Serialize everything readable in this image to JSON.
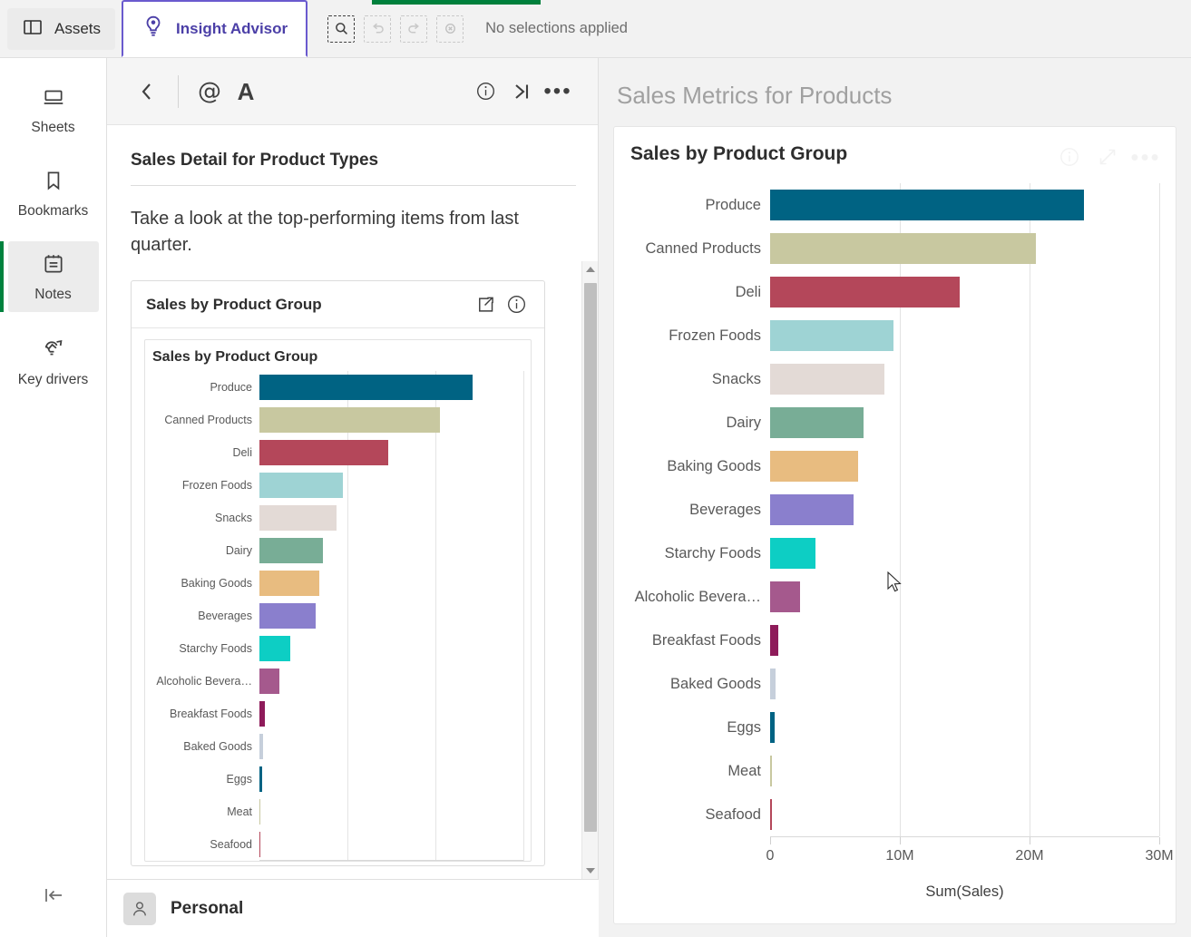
{
  "topbar": {
    "assets_label": "Assets",
    "insight_advisor_label": "Insight Advisor",
    "selection_status": "No selections applied",
    "tools": [
      {
        "name": "selection-search",
        "title": "Selection search",
        "disabled": false
      },
      {
        "name": "step-back",
        "title": "Step back",
        "disabled": true
      },
      {
        "name": "step-forward",
        "title": "Step forward",
        "disabled": true
      },
      {
        "name": "clear-selections",
        "title": "Clear all selections",
        "disabled": true
      }
    ]
  },
  "rail": {
    "items": [
      {
        "label": "Sheets",
        "icon": "sheets-icon",
        "active": false
      },
      {
        "label": "Bookmarks",
        "icon": "bookmark-icon",
        "active": false
      },
      {
        "label": "Notes",
        "icon": "notes-icon",
        "active": true
      },
      {
        "label": "Key drivers",
        "icon": "key-drivers-icon",
        "active": false
      }
    ],
    "collapse_label": "Collapse"
  },
  "note": {
    "toolbar": {
      "back_label": "‹",
      "mention_label": "@",
      "font_label": "A",
      "info_label": "i",
      "collapse_label": "›|",
      "more_label": "•••"
    },
    "title": "Sales Detail for Product Types",
    "body_text": "Take a look at the top-performing items from last quarter.",
    "embedded_card": {
      "title": "Sales by Product Group",
      "chart_title": "Sales by Product Group",
      "actions": [
        "share-icon",
        "info-icon"
      ]
    }
  },
  "main": {
    "page_title": "Sales Metrics for Products",
    "card_title": "Sales by Product Group",
    "head_icons": [
      "info-icon",
      "expand-icon",
      "more-icon"
    ]
  },
  "footer": {
    "user_name": "Personal",
    "avatar_icon": "user-icon"
  },
  "colors": {
    "brand_green": "#00803c",
    "insight_purple": "#4b3fa7",
    "panel_bg": "#f2f2f2"
  },
  "chart_data": {
    "type": "bar",
    "orientation": "horizontal",
    "title": "Sales by Product Group",
    "xlabel": "Sum(Sales)",
    "ylabel": "",
    "xlim": [
      0,
      30000000
    ],
    "xticks": [
      0,
      10000000,
      20000000,
      30000000
    ],
    "xtick_labels": [
      "0",
      "10M",
      "20M",
      "30M"
    ],
    "grid": true,
    "legend": "none",
    "categories": [
      "Produce",
      "Canned Products",
      "Deli",
      "Frozen Foods",
      "Snacks",
      "Dairy",
      "Baking Goods",
      "Beverages",
      "Starchy Foods",
      "Alcoholic Bevera…",
      "Breakfast Foods",
      "Baked Goods",
      "Eggs",
      "Meat",
      "Seafood"
    ],
    "values": [
      24200000,
      20500000,
      14600000,
      9500000,
      8800000,
      7200000,
      6800000,
      6400000,
      3500000,
      2300000,
      600000,
      400000,
      350000,
      120000,
      110000
    ],
    "bar_colors": [
      "#006383",
      "#c8c8a0",
      "#b4475a",
      "#9ed3d4",
      "#e3dad6",
      "#78ad96",
      "#e8bc80",
      "#8a7fcd",
      "#0dcec4",
      "#a5598d",
      "#8e1b5a",
      "#c6cfdb",
      "#006383",
      "#c8c8a0",
      "#b4475a"
    ]
  }
}
